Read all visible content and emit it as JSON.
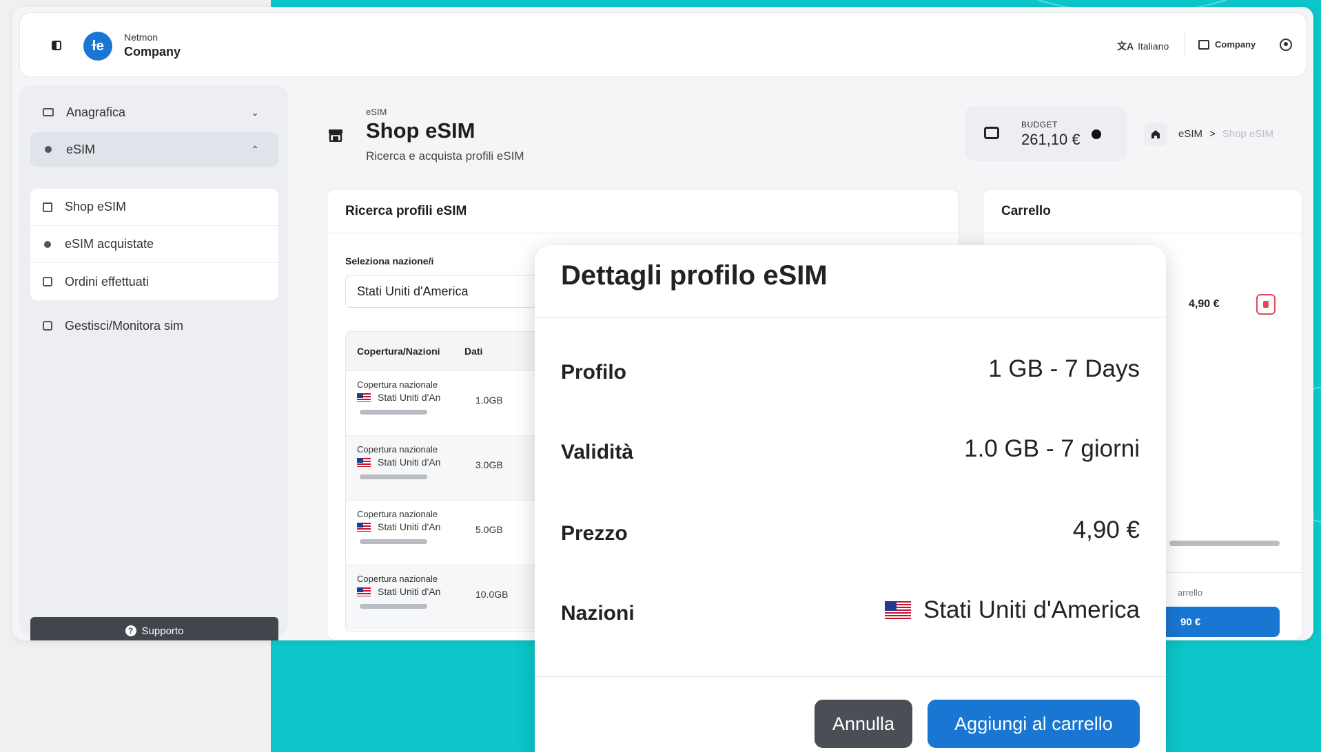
{
  "header": {
    "brand_small": "Netmon",
    "brand_big": "Company",
    "language": "Italiano",
    "company": "Company"
  },
  "sidebar": {
    "items": [
      {
        "label": "Anagrafica",
        "icon": "id-card-icon"
      },
      {
        "label": "eSIM",
        "icon": "dot-icon"
      }
    ],
    "submenu": [
      {
        "label": "Shop eSIM",
        "icon": "store-icon"
      },
      {
        "label": "eSIM acquistate",
        "icon": "dot-icon"
      },
      {
        "label": "Ordini effettuati",
        "icon": "list-icon"
      }
    ],
    "manage": {
      "label": "Gestisci/Monitora sim",
      "icon": "external-link-icon"
    },
    "support_label": "Supporto"
  },
  "page": {
    "crumb_small": "eSIM",
    "title": "Shop eSIM",
    "subtitle": "Ricerca e acquista profili eSIM"
  },
  "budget": {
    "label": "BUDGET",
    "value": "261,10 €"
  },
  "breadcrumb": {
    "item1": "eSIM",
    "separator": ">",
    "item2": "Shop eSIM"
  },
  "search_panel": {
    "title": "Ricerca profili eSIM",
    "select_label": "Seleziona nazione/i",
    "select_value": "Stati Uniti d'America",
    "columns": [
      "Copertura/Nazioni",
      "Dati"
    ],
    "rows": [
      {
        "coverage": "Copertura nazionale",
        "country": "Stati Uniti d'An",
        "data": "1.0GB"
      },
      {
        "coverage": "Copertura nazionale",
        "country": "Stati Uniti d'An",
        "data": "3.0GB"
      },
      {
        "coverage": "Copertura nazionale",
        "country": "Stati Uniti d'An",
        "data": "5.0GB"
      },
      {
        "coverage": "Copertura nazionale",
        "country": "Stati Uniti d'An",
        "data": "10.0GB"
      }
    ]
  },
  "cart_panel": {
    "title": "Carrello",
    "item_price": "4,90 €",
    "footer_text": "arrello",
    "button_text": "90 €"
  },
  "modal": {
    "title": "Dettagli profilo eSIM",
    "rows": [
      {
        "label": "Profilo",
        "value": "1 GB - 7 Days"
      },
      {
        "label": "Validità",
        "value": "1.0 GB - 7 giorni"
      },
      {
        "label": "Prezzo",
        "value": "4,90 €"
      },
      {
        "label": "Nazioni",
        "value": "Stati Uniti d'America"
      }
    ],
    "cancel_label": "Annulla",
    "add_label": "Aggiungi al carrello"
  },
  "colors": {
    "accent": "#1976d2",
    "backdrop": "#0cc6c9",
    "dark_button": "#4a4f56",
    "danger": "#e24a5a"
  }
}
